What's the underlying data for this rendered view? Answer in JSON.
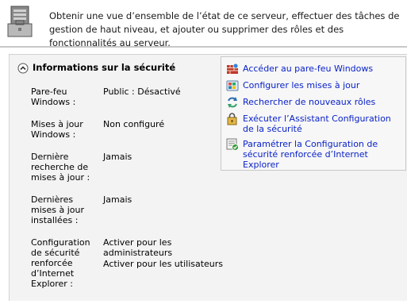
{
  "banner": {
    "icon": "server-manager-icon",
    "text": "Obtenir une vue d’ensemble de l’état de ce serveur, effectuer des tâches de gestion de haut niveau, et ajouter ou supprimer des rôles et des fonctionnalités au serveur."
  },
  "section": {
    "title": "Informations sur la sécurité",
    "collapse_icon": "collapse-up-chevron-icon",
    "properties": [
      {
        "label": "Pare-feu Windows :",
        "value": [
          "Public : Désactivé"
        ]
      },
      {
        "label": "Mises à jour Windows :",
        "value": [
          "Non configuré"
        ]
      },
      {
        "label": "Dernière recherche de mises à jour :",
        "value": [
          "Jamais"
        ]
      },
      {
        "label": "Dernières mises à jour installées :",
        "value": [
          "Jamais"
        ]
      },
      {
        "label": "Configuration de sécurité renforcée d’Internet Explorer :",
        "value": [
          "Activer pour les administrateurs",
          "Activer pour les utilisateurs"
        ]
      }
    ],
    "tasks": [
      {
        "label": "Accéder au pare-feu Windows",
        "icon": "firewall-icon"
      },
      {
        "label": "Configurer les mises à jour",
        "icon": "windows-update-icon"
      },
      {
        "label": "Rechercher de nouveaux rôles",
        "icon": "refresh-arrows-icon"
      },
      {
        "label": "Exécuter l’Assistant Configuration de la sécurité",
        "icon": "security-wizard-icon"
      },
      {
        "label": "Paramétrer la Configuration de sécurité renforcée d’Internet Explorer",
        "icon": "ie-security-icon"
      }
    ]
  }
}
